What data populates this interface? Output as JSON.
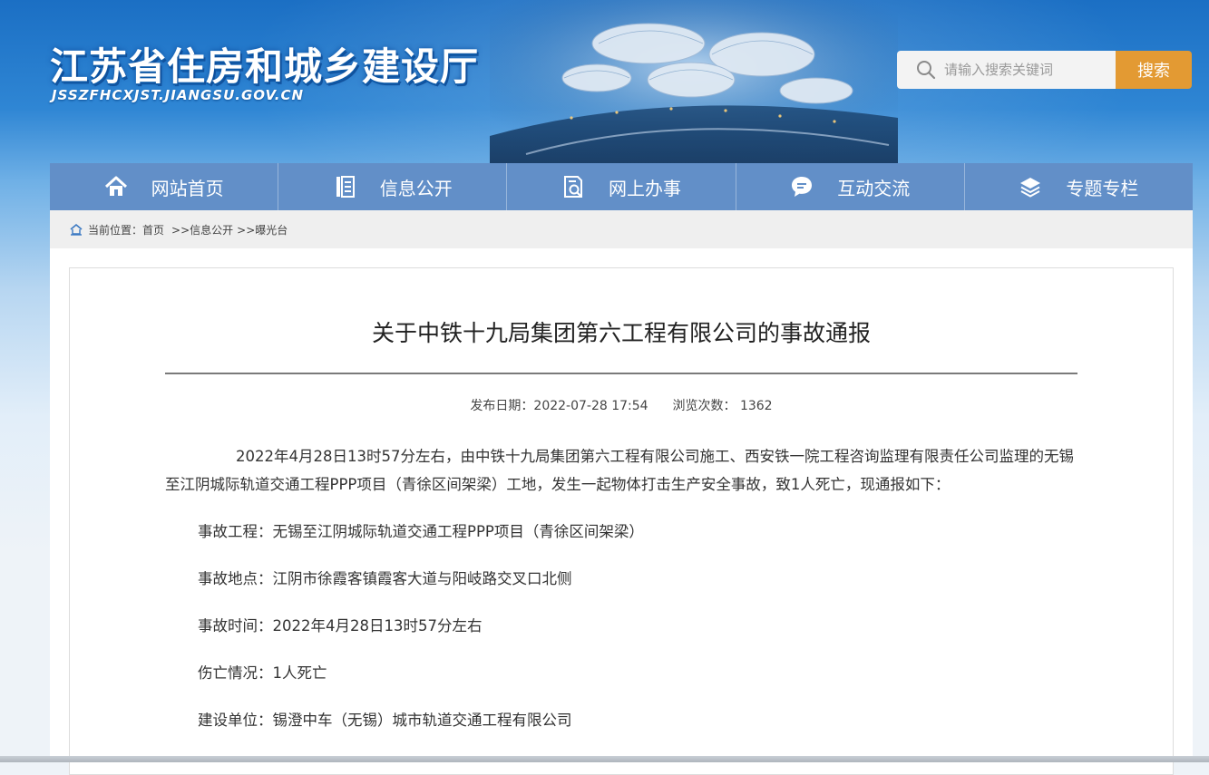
{
  "header": {
    "site_title": "江苏省住房和城乡建设厅",
    "site_domain": "JSSZFHCXJST.JIANGSU.GOV.CN"
  },
  "search": {
    "placeholder": "请输入搜索关键词",
    "button_label": "搜索"
  },
  "nav": {
    "items": [
      {
        "label": "网站首页",
        "icon": "home-icon"
      },
      {
        "label": "信息公开",
        "icon": "document-list-icon"
      },
      {
        "label": "网上办事",
        "icon": "online-service-icon"
      },
      {
        "label": "互动交流",
        "icon": "chat-bubble-icon"
      },
      {
        "label": "专题专栏",
        "icon": "layers-icon"
      }
    ]
  },
  "breadcrumb": {
    "prefix": "当前位置：",
    "items": [
      "首页",
      ">>信息公开",
      ">>曝光台"
    ]
  },
  "article": {
    "title": "关于中铁十九局集团第六工程有限公司的事故通报",
    "publish_label": "发布日期：",
    "publish_date": "2022-07-28 17:54",
    "views_label": "浏览次数：",
    "views_count": "1362",
    "lead_paragraph": "2022年4月28日13时57分左右，由中铁十九局集团第六工程有限公司施工、西安铁一院工程咨询监理有限责任公司监理的无锡至江阴城际轨道交通工程PPP项目（青徐区间架梁）工地，发生一起物体打击生产安全事故，致1人死亡，现通报如下：",
    "fields": [
      {
        "label": "事故工程：",
        "value": "无锡至江阴城际轨道交通工程PPP项目（青徐区间架梁）"
      },
      {
        "label": "事故地点：",
        "value": "江阴市徐霞客镇霞客大道与阳岐路交叉口北侧"
      },
      {
        "label": "事故时间：",
        "value": "2022年4月28日13时57分左右"
      },
      {
        "label": "伤亡情况：",
        "value": "1人死亡"
      },
      {
        "label": "建设单位：",
        "value": "锡澄中车（无锡）城市轨道交通工程有限公司"
      }
    ]
  },
  "colors": {
    "nav_bg": "#628fc8",
    "search_button": "#e39a33",
    "banner_top": "#1b6fc4"
  }
}
